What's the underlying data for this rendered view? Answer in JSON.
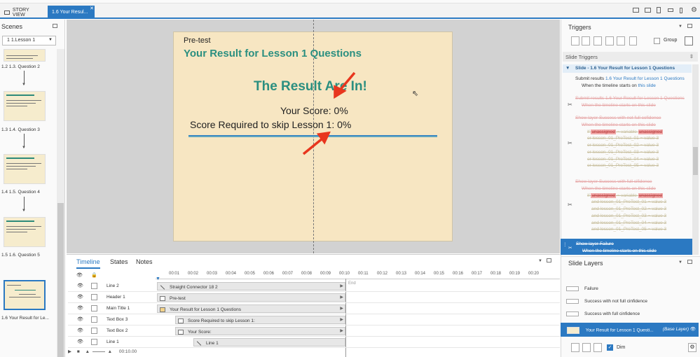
{
  "tabs": {
    "story_view": "STORY VIEW",
    "slide_tab": "1.6 Your Resul...",
    "close": "✕"
  },
  "scenes": {
    "title": "Scenes",
    "selected_scene": "1 1.Lesson 1",
    "items": [
      {
        "label": "1.2 1.3. Question 2"
      },
      {
        "label": "1.3 1.4. Question 3"
      },
      {
        "label": "1.4 1.5. Question 4"
      },
      {
        "label": "1.5 1.6. Question 5"
      },
      {
        "label": "1.6 Your Result for Le..."
      }
    ]
  },
  "slide": {
    "pretest": "Pre-test",
    "title": "Your Result for Lesson 1 Questions",
    "headline": "The Result Are In!",
    "your_score": "Your Score: 0%",
    "required": "Score Required to skip Lesson 1: 0%"
  },
  "timeline": {
    "tabs": [
      "Timeline",
      "States",
      "Notes"
    ],
    "ticks": [
      "00:01",
      "00:02",
      "00:03",
      "00:04",
      "00:05",
      "00:06",
      "00:07",
      "00:08",
      "00:09",
      "00:10",
      "00:11",
      "00:12",
      "00:13",
      "00:14",
      "00:15",
      "00:16",
      "00:17",
      "00:18",
      "00:19",
      "00:20"
    ],
    "end_label": "End",
    "rows": [
      {
        "name": "Line 2",
        "bar": "Straight Connector 18 2"
      },
      {
        "name": "Header 1",
        "bar": "Pre-test"
      },
      {
        "name": "Main Title 1",
        "bar": "Your Result for Lesson 1 Questions"
      },
      {
        "name": "Text Box 3",
        "bar": "Score Required to skip Lesson 1:"
      },
      {
        "name": "Text Box 2",
        "bar": "Your Score:"
      },
      {
        "name": "Line 1",
        "bar": "Line 1"
      }
    ],
    "time_display": "00:10.00"
  },
  "triggers": {
    "title": "Triggers",
    "group_label": "Group",
    "slide_triggers": "Slide Triggers",
    "section": "Slide - 1.6 Your Result for Lesson 1 Questions",
    "t1_action": "Submit results",
    "t1_target": "1.6 Your Result for Lesson 1 Questions",
    "t1_when": "When the timeline starts on",
    "t1_this": "this slide",
    "t2_action": "Submit results",
    "t2_target": "1.6 Your Result for Lesson 1 Questions",
    "t2_when": "When the timeline starts on this slide",
    "t3_action": "Show layer Success with not full cofidence",
    "t3_when": "When the timeline starts on this slide",
    "t3_if": "If",
    "t3_unassigned": "unassigned",
    "t3_var": "variable",
    "t3_conds": [
      "or lesson_01_PreTest_01 = value 3",
      "or lesson_01_PreTest_02 = value 3",
      "or lesson_01_PreTest_03 = value 3",
      "or lesson_01_PreTest_04 = value 3",
      "or lesson_01_PreTest_05 = value 3"
    ],
    "t4_action": "Show layer Success with full cifidence",
    "t4_when": "When the timeline starts on this slide",
    "t4_conds": [
      "and lesson_01_PreTest_01 = value 3",
      "and lesson_01_PreTest_02 = value 3",
      "and lesson_01_PreTest_03 = value 3",
      "and lesson_01_PreTest_04 = value 3",
      "and lesson_01_PreTest_05 = value 3"
    ],
    "t5_action": "Show layer Failure",
    "t5_when": "When the timeline starts on this slide"
  },
  "layers": {
    "title": "Slide Layers",
    "items": [
      "Failure",
      "Success with not full cinfidence",
      "Success with full cinfidence"
    ],
    "base": "Your Result for Lesson 1 Questi...",
    "base_tag": "(Base Layer)",
    "dim_label": "Dim"
  }
}
